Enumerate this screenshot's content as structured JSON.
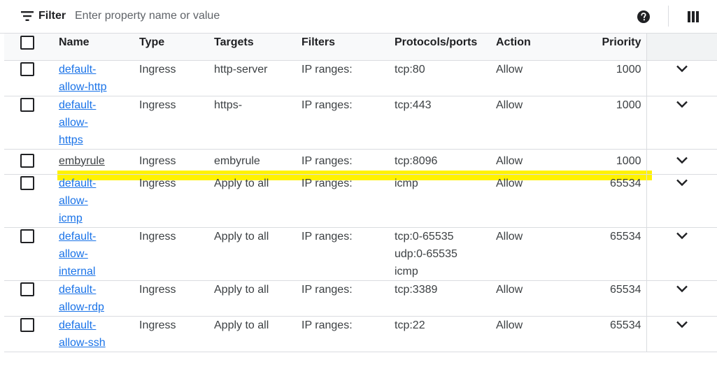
{
  "toolbar": {
    "filter_label": "Filter",
    "filter_placeholder": "Enter property name or value"
  },
  "table": {
    "headers": {
      "name": "Name",
      "type": "Type",
      "targets": "Targets",
      "filters": "Filters",
      "protocols": "Protocols/ports",
      "action": "Action",
      "priority": "Priority"
    },
    "rows": [
      {
        "name_lines": [
          "default-",
          "allow-http"
        ],
        "type": "Ingress",
        "targets": "http-server",
        "filters": "IP ranges:",
        "protocols": [
          "tcp:80"
        ],
        "action": "Allow",
        "priority": "1000"
      },
      {
        "name_lines": [
          "default-",
          "allow-",
          "https"
        ],
        "type": "Ingress",
        "targets": "https-",
        "filters": "IP ranges:",
        "protocols": [
          "tcp:443"
        ],
        "action": "Allow",
        "priority": "1000"
      },
      {
        "name_lines": [
          "embyrule"
        ],
        "type": "Ingress",
        "targets": "embyrule",
        "filters": "IP ranges:",
        "protocols": [
          "tcp:8096"
        ],
        "action": "Allow",
        "priority": "1000",
        "highlight_color": "#fff200"
      },
      {
        "name_lines": [
          "default-",
          "allow-",
          "icmp"
        ],
        "type": "Ingress",
        "targets": "Apply to all",
        "filters": "IP ranges:",
        "protocols": [
          "icmp"
        ],
        "action": "Allow",
        "priority": "65534"
      },
      {
        "name_lines": [
          "default-",
          "allow-",
          "internal"
        ],
        "type": "Ingress",
        "targets": "Apply to all",
        "filters": "IP ranges:",
        "protocols": [
          "tcp:0-65535",
          "udp:0-65535",
          "icmp"
        ],
        "action": "Allow",
        "priority": "65534"
      },
      {
        "name_lines": [
          "default-",
          "allow-rdp"
        ],
        "type": "Ingress",
        "targets": "Apply to all",
        "filters": "IP ranges:",
        "protocols": [
          "tcp:3389"
        ],
        "action": "Allow",
        "priority": "65534"
      },
      {
        "name_lines": [
          "default-",
          "allow-ssh"
        ],
        "type": "Ingress",
        "targets": "Apply to all",
        "filters": "IP ranges:",
        "protocols": [
          "tcp:22"
        ],
        "action": "Allow",
        "priority": "65534"
      }
    ]
  },
  "colors": {
    "link": "#1a73e8",
    "highlight": "#fff200",
    "border": "#dadce0"
  },
  "icons": [
    "filter-icon",
    "help-icon",
    "columns-icon",
    "chevron-down-icon"
  ]
}
